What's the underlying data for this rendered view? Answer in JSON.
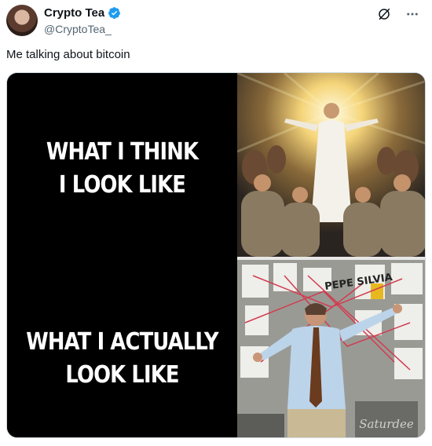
{
  "tweet": {
    "author_name": "Crypto Tea",
    "author_handle": "@CryptoTea_",
    "text": "Me talking about bitcoin",
    "verified": true
  },
  "icons": {
    "verified": "verified-badge-icon",
    "grok": "grok-icon",
    "more": "more-icon"
  },
  "meme": {
    "caption_top_line1": "WHAT I THINK",
    "caption_top_line2": "I LOOK LIKE",
    "caption_bottom_line1": "WHAT I ACTUALLY",
    "caption_bottom_line2": "LOOK LIKE",
    "watermark": "Saturdee",
    "sign_text": "PEPE SILVIA"
  },
  "colors": {
    "verified_blue": "#1d9bf0",
    "text_primary": "#0f1419",
    "text_secondary": "#536471"
  }
}
